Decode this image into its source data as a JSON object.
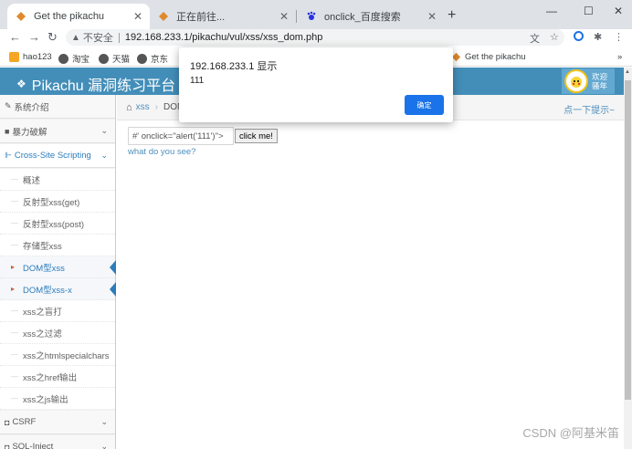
{
  "browser": {
    "tabs": [
      {
        "title": "Get the pikachu",
        "active": true
      },
      {
        "title": "正在前往...",
        "active": false
      },
      {
        "title": "onclick_百度搜索",
        "active": false
      }
    ],
    "new_tab": "+",
    "window_controls": {
      "minimize": "—",
      "maximize": "☐",
      "close": "✕"
    },
    "address": {
      "security_label": "不安全",
      "url": "192.168.233.1/pikachu/vul/xss/xss_dom.php"
    },
    "bookmarks": [
      "hao123",
      "淘宝",
      "天猫",
      "京东",
      "Get the pikachu"
    ],
    "bookmarks_more": "»"
  },
  "header": {
    "brand": "Pikachu 漏洞练习平台 pika",
    "welcome_line1": "欢迎",
    "welcome_line2": "骚年"
  },
  "sidebar": {
    "groups": [
      {
        "label": "系统介绍",
        "icon": "tag-icon"
      },
      {
        "label": "暴力破解",
        "icon": "lock-icon"
      },
      {
        "label": "Cross-Site Scripting",
        "icon": "sitemap-icon"
      }
    ],
    "xss_items": [
      "概述",
      "反射型xss(get)",
      "反射型xss(post)",
      "存储型xss",
      "DOM型xss",
      "DOM型xss-x",
      "xss之盲打",
      "xss之过滤",
      "xss之htmlspecialchars",
      "xss之href输出",
      "xss之js输出"
    ],
    "active_items": [
      "DOM型xss",
      "DOM型xss-x"
    ],
    "bottom_groups": [
      {
        "label": "CSRF"
      },
      {
        "label": "SQL-Inject"
      }
    ]
  },
  "breadcrumb": {
    "link": "xss",
    "current": "DOM"
  },
  "tips": "点一下提示~",
  "form": {
    "input_value": "#' onclick=\"alert('111')\">",
    "button_label": "click me!",
    "result": "what do you see?"
  },
  "dialog": {
    "title": "192.168.233.1 显示",
    "message": "111",
    "ok_label": "确定"
  },
  "watermark": "CSDN @阿基米笛",
  "colors": {
    "header": "#438eb9",
    "link": "#4c8fbd",
    "dialog_button": "#1a73e8"
  }
}
